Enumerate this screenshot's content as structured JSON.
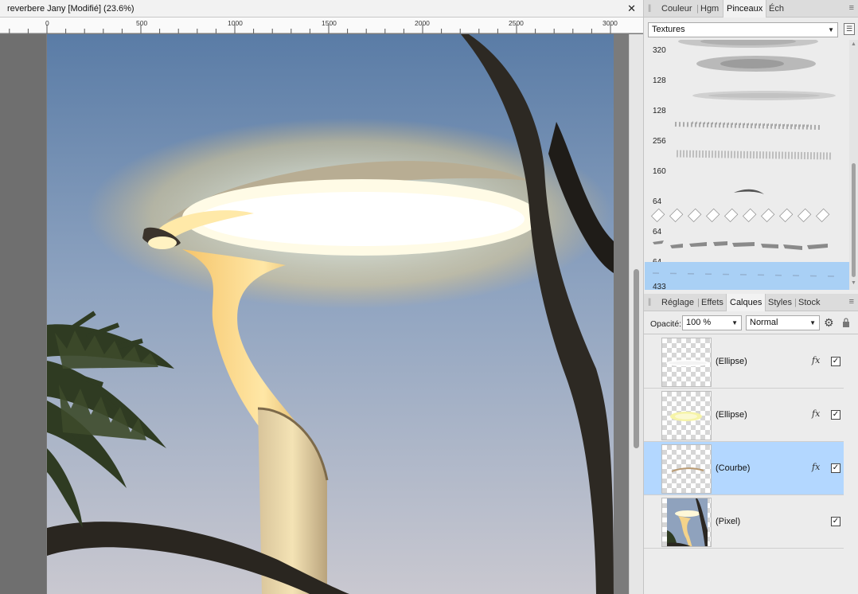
{
  "document": {
    "title": "reverbere Jany [Modifié] (23.6%)",
    "close_icon": "✕",
    "ruler_labels": [
      "0",
      "500",
      "1000",
      "1500",
      "2000",
      "2500",
      "3000"
    ]
  },
  "brush_panel": {
    "tabs": [
      "Couleur",
      "Hgm",
      "Pinceaux",
      "Éch"
    ],
    "active_tab": "Pinceaux",
    "category": "Textures",
    "brushes": [
      {
        "size": "320"
      },
      {
        "size": "128"
      },
      {
        "size": "128"
      },
      {
        "size": "256"
      },
      {
        "size": "160"
      },
      {
        "size": "64"
      },
      {
        "size": "64"
      },
      {
        "size": "64"
      },
      {
        "size": "433",
        "selected": true
      }
    ]
  },
  "layer_panel": {
    "tabs": [
      "Réglage",
      "Effets",
      "Calques",
      "Styles",
      "Stock"
    ],
    "active_tab": "Calques",
    "opacity_label": "Opacité:",
    "opacity_value": "100 %",
    "blend_mode": "Normal",
    "fx_label": "fx",
    "check_mark": "✓",
    "layers": [
      {
        "name": "(Ellipse)",
        "has_fx": true,
        "visible": true
      },
      {
        "name": "(Ellipse)",
        "has_fx": true,
        "visible": true
      },
      {
        "name": "(Courbe)",
        "has_fx": true,
        "visible": true,
        "selected": true
      },
      {
        "name": "(Pixel)",
        "has_fx": false,
        "visible": true
      }
    ]
  },
  "colors": {
    "selection": "#b3d7ff",
    "brush_selection": "#a9d0f5",
    "sky_top": "#5e7fa8",
    "sky_bottom": "#c8c9d2",
    "glow": "#fff6c8"
  }
}
